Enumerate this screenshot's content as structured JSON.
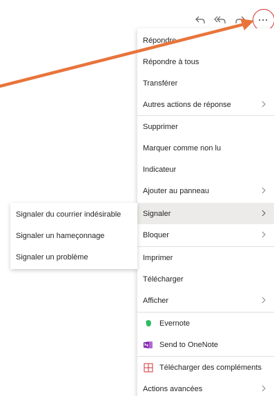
{
  "toolbar": {
    "reply_icon": "reply-icon",
    "reply_all_icon": "reply-all-icon",
    "forward_icon": "forward-icon",
    "more_label": "···"
  },
  "menu": {
    "items": [
      {
        "label": "Répondre",
        "submenu": false
      },
      {
        "label": "Répondre à tous",
        "submenu": false
      },
      {
        "label": "Transférer",
        "submenu": false
      },
      {
        "label": "Autres actions de réponse",
        "submenu": true
      },
      {
        "label": "Supprimer",
        "submenu": false
      },
      {
        "label": "Marquer comme non lu",
        "submenu": false
      },
      {
        "label": "Indicateur",
        "submenu": false
      },
      {
        "label": "Ajouter au panneau",
        "submenu": true
      },
      {
        "label": "Signaler",
        "submenu": true,
        "active": true
      },
      {
        "label": "Bloquer",
        "submenu": true
      },
      {
        "label": "Imprimer",
        "submenu": false
      },
      {
        "label": "Télécharger",
        "submenu": false
      },
      {
        "label": "Afficher",
        "submenu": true
      },
      {
        "label": "Evernote",
        "icon": "evernote-icon"
      },
      {
        "label": "Send to OneNote",
        "icon": "onenote-icon"
      },
      {
        "label": "Télécharger des compléments",
        "icon": "add-ins-grid-icon"
      },
      {
        "label": "Actions avancées",
        "submenu": true
      }
    ]
  },
  "submenu": {
    "items": [
      {
        "label": "Signaler du courrier indésirable"
      },
      {
        "label": "Signaler un hameçonnage"
      },
      {
        "label": "Signaler un problème"
      }
    ]
  },
  "colors": {
    "annotation_arrow": "#e8743b",
    "highlight_circle": "#d13438",
    "active_bg": "#edebe9",
    "evernote_green": "#2dbe60",
    "onenote_purple": "#7719aa"
  }
}
